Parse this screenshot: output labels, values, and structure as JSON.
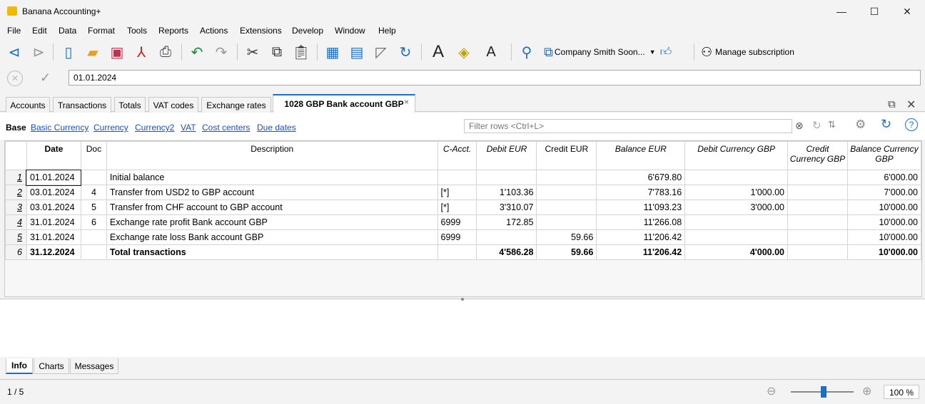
{
  "window": {
    "title": "Banana Accounting+",
    "minimize": "—",
    "maximize": "☐",
    "close": "✕"
  },
  "menu": [
    "File",
    "Edit",
    "Data",
    "Format",
    "Tools",
    "Reports",
    "Actions",
    "Extensions",
    "Develop",
    "Window",
    "Help"
  ],
  "toolbar": {
    "company": "Company Smith Soon...",
    "manage_subscription": "Manage subscription"
  },
  "editbar": {
    "value": "01.01.2024"
  },
  "tabs": [
    "Accounts",
    "Transactions",
    "Totals",
    "VAT codes",
    "Exchange rates",
    "1028 GBP Bank account GBP"
  ],
  "active_tab_close": "×",
  "views": {
    "base": "Base",
    "links": [
      "Basic Currency",
      "Currency",
      "Currency2",
      "VAT",
      "Cost centers",
      "Due dates"
    ]
  },
  "filter": {
    "placeholder": "Filter rows <Ctrl+L>"
  },
  "table": {
    "headers": [
      "Date",
      "Doc",
      "Description",
      "C-Acct.",
      "Debit EUR",
      "Credit EUR",
      "Balance EUR",
      "Debit Currency GBP",
      "Credit Currency GBP",
      "Balance Currency GBP"
    ],
    "rows": [
      [
        "1",
        "01.01.2024",
        "",
        "Initial balance",
        "",
        "",
        "",
        "6'679.80",
        "",
        "",
        "6'000.00"
      ],
      [
        "2",
        "03.01.2024",
        "4",
        "Transfer from USD2 to GBP account",
        "[*]",
        "1'103.36",
        "",
        "7'783.16",
        "1'000.00",
        "",
        "7'000.00"
      ],
      [
        "3",
        "03.01.2024",
        "5",
        "Transfer from CHF account to GBP account",
        "[*]",
        "3'310.07",
        "",
        "11'093.23",
        "3'000.00",
        "",
        "10'000.00"
      ],
      [
        "4",
        "31.01.2024",
        "6",
        "Exchange rate profit Bank account GBP",
        "6999",
        "172.85",
        "",
        "11'266.08",
        "",
        "",
        "10'000.00"
      ],
      [
        "5",
        "31.01.2024",
        "",
        "Exchange rate loss Bank account GBP",
        "6999",
        "",
        "59.66",
        "11'206.42",
        "",
        "",
        "10'000.00"
      ],
      [
        "6",
        "31.12.2024",
        "",
        "Total transactions",
        "",
        "4'586.28",
        "59.66",
        "11'206.42",
        "4'000.00",
        "",
        "10'000.00"
      ]
    ]
  },
  "bottom_tabs": [
    "Info",
    "Charts",
    "Messages"
  ],
  "status": {
    "row_position": "1 / 5",
    "zoom": "100 %"
  }
}
